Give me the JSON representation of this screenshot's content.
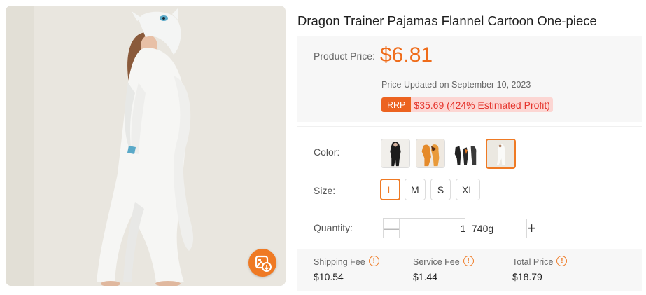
{
  "product": {
    "title": "Dragon Trainer Pajamas Flannel Cartoon One-piece",
    "image_icon": "image-search-icon"
  },
  "price": {
    "label": "Product Price:",
    "value": "$6.81",
    "updated": "Price Updated on September 10, 2023",
    "rrp_tag": "RRP",
    "rrp_profit": "$35.69 (424% Estimated Profit)"
  },
  "color": {
    "label": "Color:",
    "options": [
      {
        "name": "black",
        "selected": false
      },
      {
        "name": "orange",
        "selected": false
      },
      {
        "name": "mixed",
        "selected": false
      },
      {
        "name": "white",
        "selected": true
      }
    ]
  },
  "size": {
    "label": "Size:",
    "options": [
      {
        "label": "L",
        "selected": true
      },
      {
        "label": "M",
        "selected": false
      },
      {
        "label": "S",
        "selected": false
      },
      {
        "label": "XL",
        "selected": false
      }
    ]
  },
  "quantity": {
    "label": "Quantity:",
    "minus": "—",
    "value": "1",
    "plus": "+",
    "weight": "740g"
  },
  "fees": {
    "shipping": {
      "label": "Shipping Fee",
      "value": "$10.54"
    },
    "service": {
      "label": "Service Fee",
      "value": "$1.44"
    },
    "total": {
      "label": "Total Price",
      "value": "$18.79"
    },
    "info_icon": "!"
  },
  "colors": {
    "accent": "#ef7a24",
    "price": "#ef6c1a",
    "profit_bg": "#fcd6d3",
    "profit_text": "#e5342c"
  }
}
